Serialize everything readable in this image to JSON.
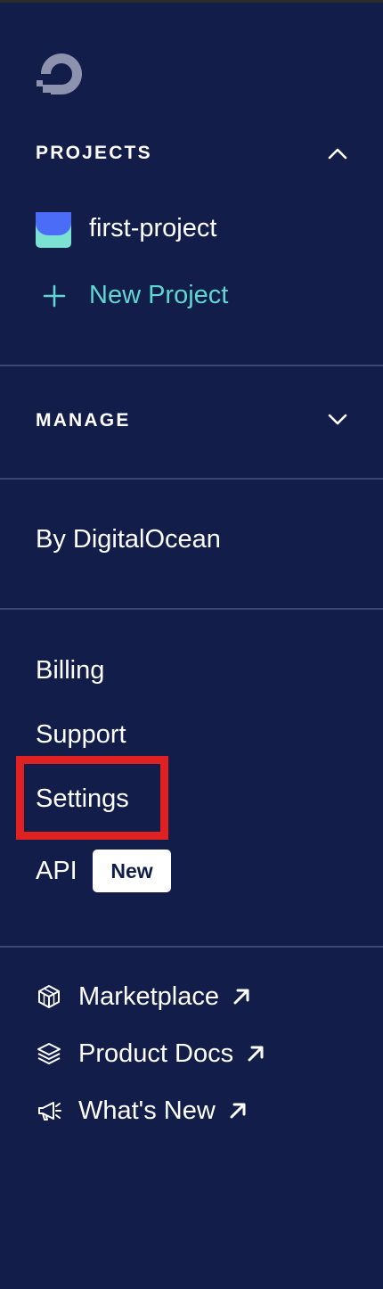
{
  "icons": {
    "logo": "digitalocean-logo-icon",
    "projects_toggle": "chevron-up-icon",
    "project_icon": "project-icon",
    "new_project_icon": "plus-icon",
    "manage_toggle": "chevron-down-icon",
    "external_link": "external-link-arrow-icon",
    "marketplace": "cube-icon",
    "docs": "layers-icon",
    "whats_new": "megaphone-icon"
  },
  "colors": {
    "background": "#121d4a",
    "divider": "#3c4670",
    "accent": "#5fd6d0",
    "highlight": "#e02121",
    "project_icon_top": "#4a6cf7",
    "project_icon_bottom": "#7ce0d3"
  },
  "projects": {
    "title": "PROJECTS",
    "items": [
      {
        "label": "first-project"
      }
    ],
    "new_label": "New Project"
  },
  "manage": {
    "title": "MANAGE"
  },
  "by_digitalocean": {
    "label": "By DigitalOcean"
  },
  "account": {
    "billing": "Billing",
    "support": "Support",
    "settings": "Settings",
    "api": "API",
    "api_badge": "New"
  },
  "external": {
    "marketplace": "Marketplace",
    "docs": "Product Docs",
    "whats_new": "What's New"
  }
}
